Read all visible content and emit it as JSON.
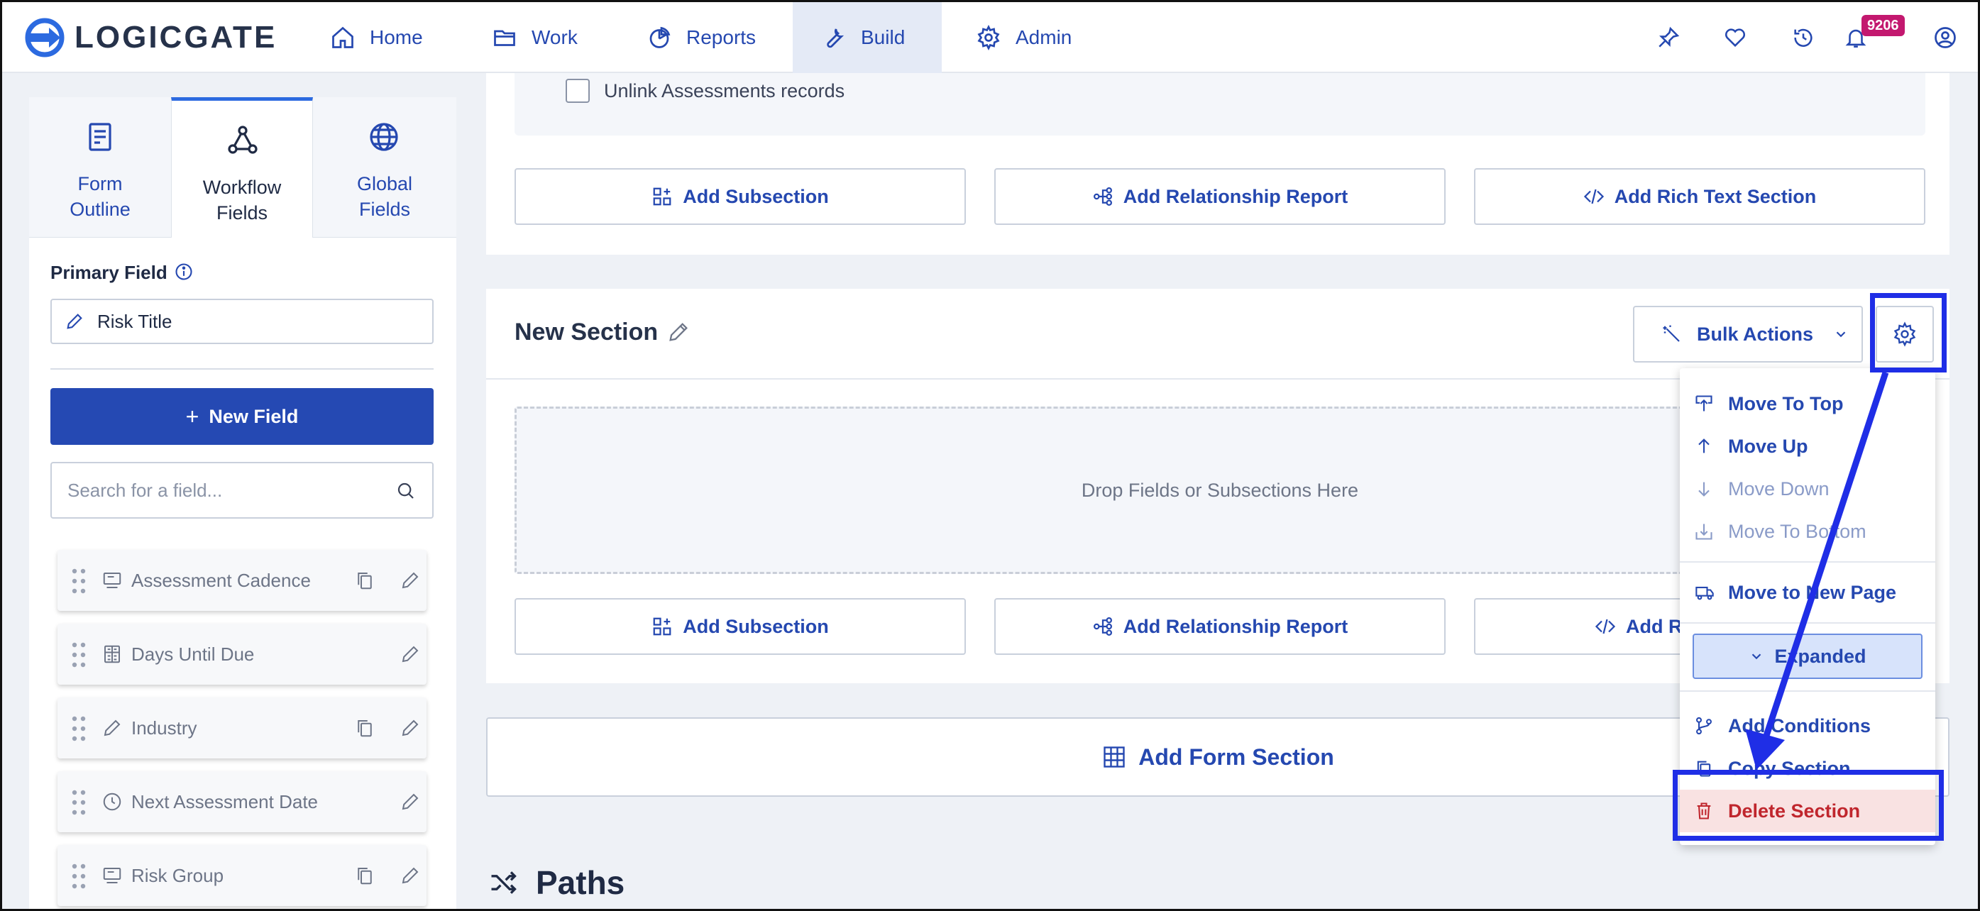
{
  "nav": {
    "logo_text": "LOGICGATE",
    "items": [
      {
        "label": "Home",
        "icon": "home-icon"
      },
      {
        "label": "Work",
        "icon": "folder-icon"
      },
      {
        "label": "Reports",
        "icon": "pie-chart-icon"
      },
      {
        "label": "Build",
        "icon": "wrench-icon",
        "active": true
      },
      {
        "label": "Admin",
        "icon": "gear-icon"
      }
    ],
    "notification_count": "9206",
    "right_icons": [
      "pin-icon",
      "heart-icon",
      "history-icon",
      "bell-icon",
      "user-icon"
    ]
  },
  "left_panel": {
    "tabs": [
      {
        "label": "Form Outline",
        "icon": "document-icon"
      },
      {
        "label": "Workflow Fields",
        "icon": "workflow-icon",
        "active": true
      },
      {
        "label": "Global Fields",
        "icon": "globe-icon"
      }
    ],
    "primary_field_label": "Primary Field",
    "primary_field_value": "Risk Title",
    "new_field_label": "New Field",
    "search_placeholder": "Search for a field...",
    "fields": [
      {
        "label": "Assessment Cadence",
        "icon": "select-icon",
        "copyable": true
      },
      {
        "label": "Days Until Due",
        "icon": "calculator-icon",
        "copyable": false
      },
      {
        "label": "Industry",
        "icon": "pencil-icon",
        "copyable": true
      },
      {
        "label": "Next Assessment Date",
        "icon": "clock-icon",
        "copyable": false
      },
      {
        "label": "Risk Group",
        "icon": "select-icon",
        "copyable": true
      }
    ]
  },
  "main": {
    "unlink_label": "Unlink Assessments records",
    "buttons": {
      "add_subsection": "Add Subsection",
      "add_relationship_report": "Add Relationship Report",
      "add_rich_text_section": "Add Rich Text Section",
      "add_rich_text_section_truncated": "Add Ric"
    },
    "new_section_title": "New Section",
    "bulk_actions": "Bulk Actions",
    "dropzone_text": "Drop Fields or Subsections Here",
    "add_form_section": "Add Form Section",
    "paths_heading": "Paths"
  },
  "menu": {
    "move_to_top": "Move To Top",
    "move_up": "Move Up",
    "move_down": "Move Down",
    "move_to_bottom": "Move To Bottom",
    "move_to_new_page": "Move to New Page",
    "expanded": "Expanded",
    "add_conditions": "Add Conditions",
    "copy_section": "Copy Section",
    "delete_section": "Delete Section"
  },
  "colors": {
    "accent": "#2548b0",
    "primary_button": "#2549b3",
    "danger": "#c0262d",
    "annotation": "#1f2ee6",
    "badge": "#c3186f"
  }
}
